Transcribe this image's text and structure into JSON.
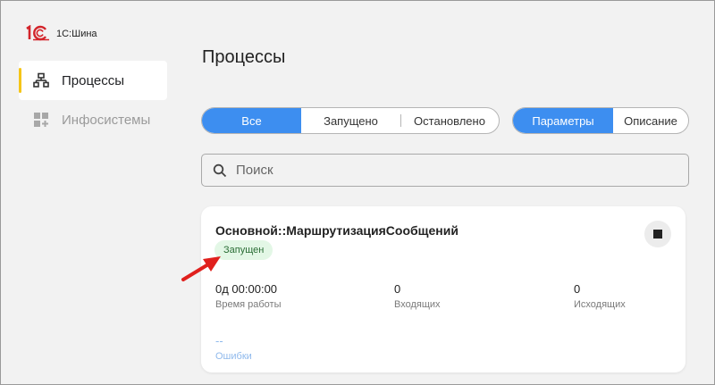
{
  "app": {
    "logo_text": "1С:Шина",
    "brand_colors": {
      "logo": "#d3242a",
      "accent": "#3d8ef0",
      "nav_marker": "#f5c518"
    }
  },
  "sidebar": {
    "items": [
      {
        "label": "Процессы",
        "icon": "hierarchy-icon",
        "active": true
      },
      {
        "label": "Инфосистемы",
        "icon": "apps-add-icon",
        "active": false
      }
    ]
  },
  "main": {
    "title": "Процессы",
    "filter_tabs": [
      {
        "label": "Все",
        "selected": true
      },
      {
        "label": "Запущено",
        "selected": false
      },
      {
        "label": "Остановлено",
        "selected": false
      }
    ],
    "view_tabs": [
      {
        "label": "Параметры",
        "selected": true
      },
      {
        "label": "Описание",
        "selected": false
      }
    ],
    "search": {
      "placeholder": "Поиск",
      "value": ""
    },
    "process_card": {
      "name": "Основной::МаршрутизацияСообщений",
      "status": "Запущен",
      "uptime_value": "0д 00:00:00",
      "uptime_label": "Время работы",
      "incoming_value": "0",
      "incoming_label": "Входящих",
      "outgoing_value": "0",
      "outgoing_label": "Исходящих",
      "errors_value": "--",
      "errors_label": "Ошибки"
    }
  }
}
